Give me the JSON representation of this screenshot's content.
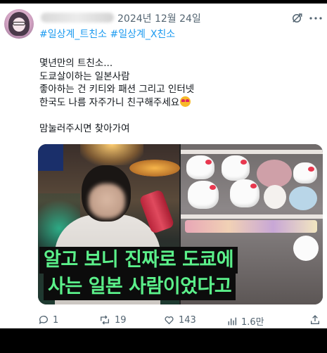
{
  "post": {
    "date": "2024년 12월 24일",
    "hashtags": "#일상계_트친소 #일상계_Ⅹ친소",
    "lines": [
      "몇년만의 트친소...",
      "도쿄살이하는 일본사람",
      "좋아하는 건 키티와 패션 그리고 인터넷",
      "한국도 나름 자주가니 친구해주세요",
      "",
      "맘눌러주시면 찾아가여"
    ],
    "emoji": "heart-eyes-emoji"
  },
  "media": {
    "subtitle_line1": "알고 보니 진짜로 도쿄에",
    "subtitle_line2": "사는 일본 사람이었다고"
  },
  "actions": {
    "reply_count": "1",
    "repost_count": "19",
    "like_count": "143",
    "view_count": "1.6만"
  },
  "icons": [
    "avatar",
    "refresh-icon",
    "more-icon",
    "reply-icon",
    "repost-icon",
    "like-icon",
    "views-icon",
    "share-icon"
  ],
  "colors": {
    "link": "#1d9bf0",
    "secondary_text": "#536471",
    "subtitle_text": "#5bf08a"
  }
}
